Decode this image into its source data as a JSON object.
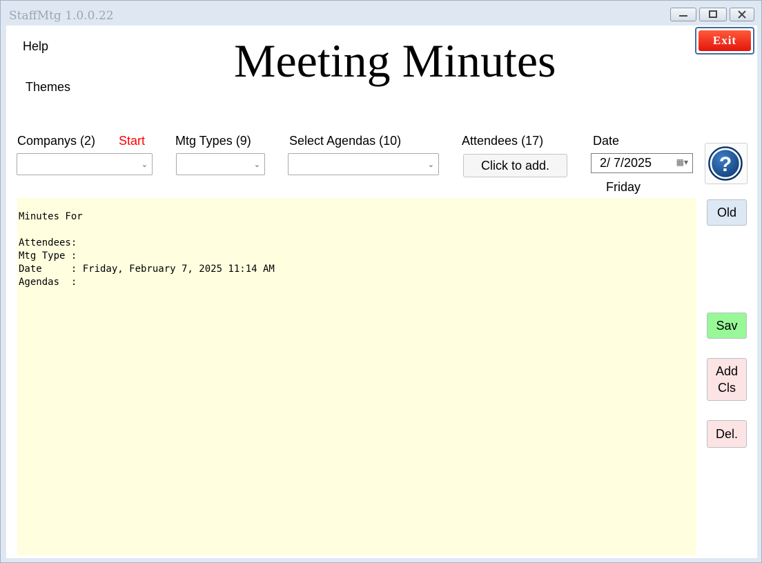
{
  "window": {
    "title": "StaffMtg 1.0.0.22",
    "min_icon": "minimize-icon",
    "max_icon": "maximize-icon",
    "close_icon": "close-icon"
  },
  "menu": {
    "help": "Help",
    "themes": "Themes"
  },
  "header": {
    "title": "Meeting Minutes",
    "exit_label": "Exit"
  },
  "filters": {
    "companys_label": "Companys (2)",
    "start_label": "Start",
    "mtg_types_label": "Mtg Types (9)",
    "agendas_label": "Select Agendas (10)",
    "attendees_label": "Attendees (17)",
    "attendees_button": "Click to add.",
    "date_label": "Date",
    "date_value": "2/  7/2025",
    "day_of_week": "Friday"
  },
  "sidebar": {
    "old": "Old",
    "save": "Sav",
    "add_cls": "Add\nCls",
    "delete": "Del."
  },
  "minutes_text": "Minutes For\n\nAttendees:\nMtg Type :\nDate     : Friday, February 7, 2025 11:14 AM\nAgendas  :",
  "colors": {
    "exit_red": "#e4150c",
    "start_red": "#ff0000",
    "minutes_bg": "#ffffe0",
    "old_bg": "#dce8f4",
    "save_bg": "#98f898",
    "add_del_bg": "#fde4e4",
    "help_blue": "#1a4f8f"
  }
}
